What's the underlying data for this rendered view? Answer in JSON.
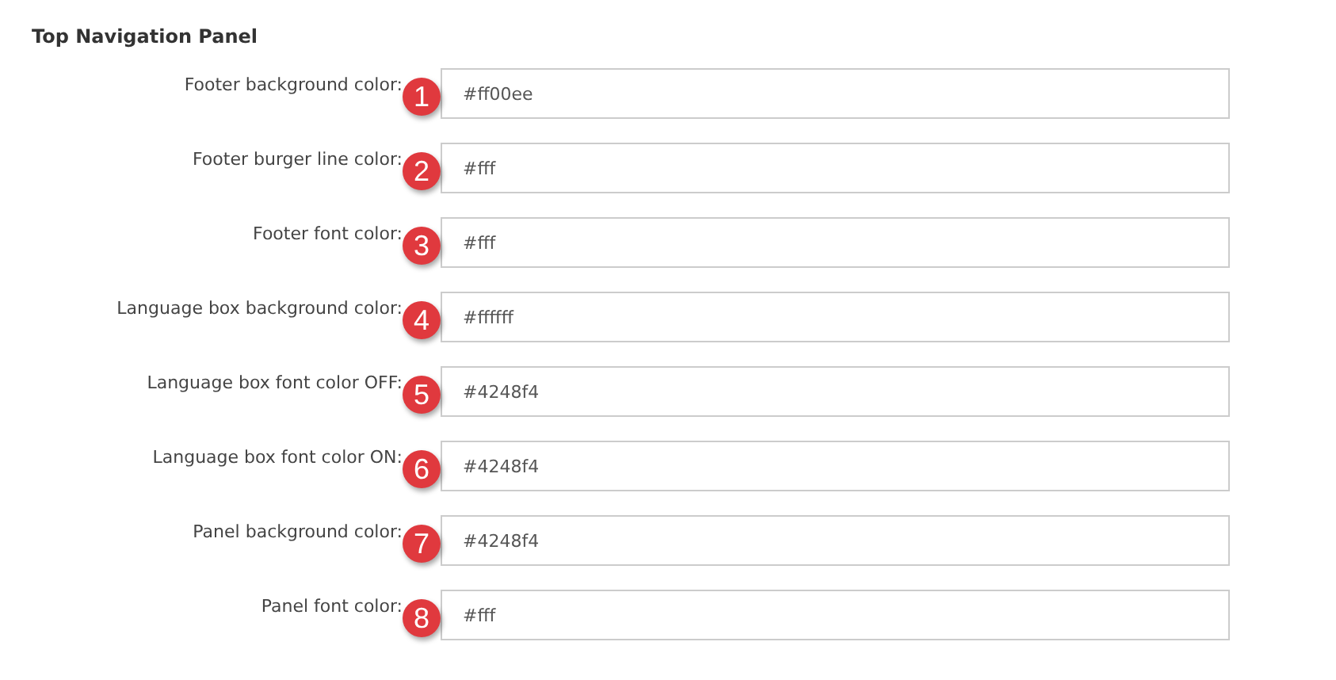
{
  "section_title": "Top Navigation Panel",
  "fields": [
    {
      "label": "Footer background color:",
      "badge": "1",
      "value": "#ff00ee"
    },
    {
      "label": "Footer burger line color:",
      "badge": "2",
      "value": "#fff"
    },
    {
      "label": "Footer font color:",
      "badge": "3",
      "value": "#fff"
    },
    {
      "label": "Language box background color:",
      "badge": "4",
      "value": "#ffffff"
    },
    {
      "label": "Language box font color OFF:",
      "badge": "5",
      "value": "#4248f4"
    },
    {
      "label": "Language box font color ON:",
      "badge": "6",
      "value": "#4248f4"
    },
    {
      "label": "Panel background color:",
      "badge": "7",
      "value": "#4248f4"
    },
    {
      "label": "Panel font color:",
      "badge": "8",
      "value": "#fff"
    }
  ]
}
